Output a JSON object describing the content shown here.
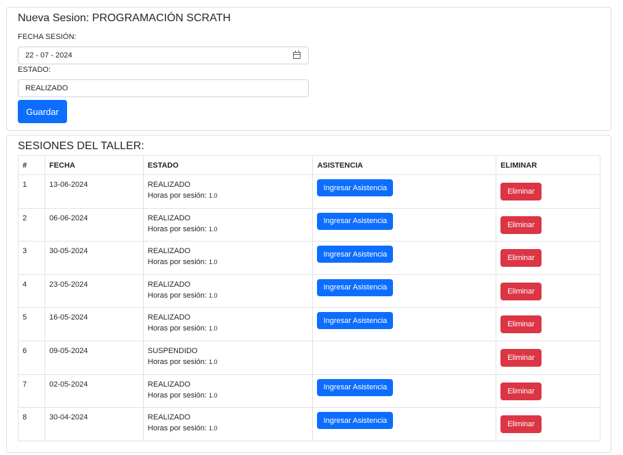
{
  "form": {
    "title": "Nueva Sesion: PROGRAMACIÓN SCRATH",
    "fecha_label": "FECHA SESIÓN:",
    "fecha_value": "22 - 07 - 2024",
    "estado_label": "ESTADO:",
    "estado_value": "REALIZADO",
    "save_label": "Guardar"
  },
  "sessions": {
    "title": "SESIONES DEL TALLER:",
    "headers": {
      "num": "#",
      "fecha": "FECHA",
      "estado": "ESTADO",
      "asistencia": "ASISTENCIA",
      "eliminar": "ELIMINAR"
    },
    "hours_label": "Horas por sesión:",
    "asistencia_label": "Ingresar Asistencia",
    "eliminar_label": "Eliminar",
    "rows": [
      {
        "num": "1",
        "fecha": "13-06-2024",
        "estado": "REALIZADO",
        "horas": "1.0"
      },
      {
        "num": "2",
        "fecha": "06-06-2024",
        "estado": "REALIZADO",
        "horas": "1.0"
      },
      {
        "num": "3",
        "fecha": "30-05-2024",
        "estado": "REALIZADO",
        "horas": "1.0"
      },
      {
        "num": "4",
        "fecha": "23-05-2024",
        "estado": "REALIZADO",
        "horas": "1.0"
      },
      {
        "num": "5",
        "fecha": "16-05-2024",
        "estado": "REALIZADO",
        "horas": "1.0"
      },
      {
        "num": "6",
        "fecha": "09-05-2024",
        "estado": "SUSPENDIDO",
        "horas": "1.0"
      },
      {
        "num": "7",
        "fecha": "02-05-2024",
        "estado": "REALIZADO",
        "horas": "1.0"
      },
      {
        "num": "8",
        "fecha": "30-04-2024",
        "estado": "REALIZADO",
        "horas": "1.0"
      }
    ]
  },
  "colors": {
    "primary": "#0d6efd",
    "danger": "#dc3545",
    "border": "#dee2e6"
  }
}
